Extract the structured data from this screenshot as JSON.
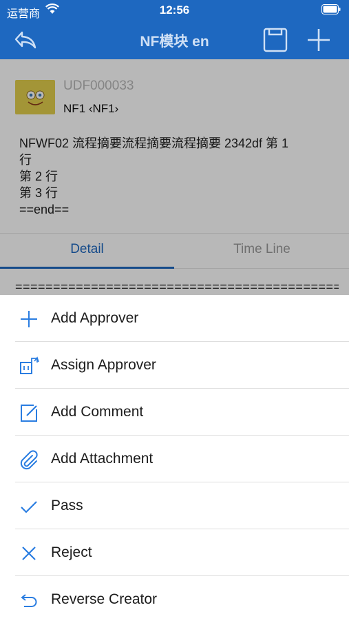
{
  "status_bar": {
    "carrier": "运营商",
    "time": "12:56"
  },
  "nav": {
    "title": "NF模块 en"
  },
  "record": {
    "code": "UDF000033",
    "name": "NF1 ‹NF1›",
    "description_lines": [
      "NFWF02 流程摘要流程摘要流程摘要 2342df 第 1",
      "行",
      "第 2 行",
      "第 3 行",
      "==end=="
    ]
  },
  "tabs": [
    {
      "label": "Detail",
      "active": true
    },
    {
      "label": "Time Line",
      "active": false
    }
  ],
  "detail": {
    "separator": "================================================"
  },
  "actions": [
    {
      "label": "Add Approver",
      "icon": "plus-icon"
    },
    {
      "label": "Assign Approver",
      "icon": "assign-icon"
    },
    {
      "label": "Add Comment",
      "icon": "edit-icon"
    },
    {
      "label": "Add Attachment",
      "icon": "paperclip-icon"
    },
    {
      "label": "Pass",
      "icon": "check-icon"
    },
    {
      "label": "Reject",
      "icon": "close-icon"
    },
    {
      "label": "Reverse Creator",
      "icon": "return-icon"
    }
  ],
  "colors": {
    "primary": "#1e68c0",
    "icon_blue": "#2a7de1"
  }
}
